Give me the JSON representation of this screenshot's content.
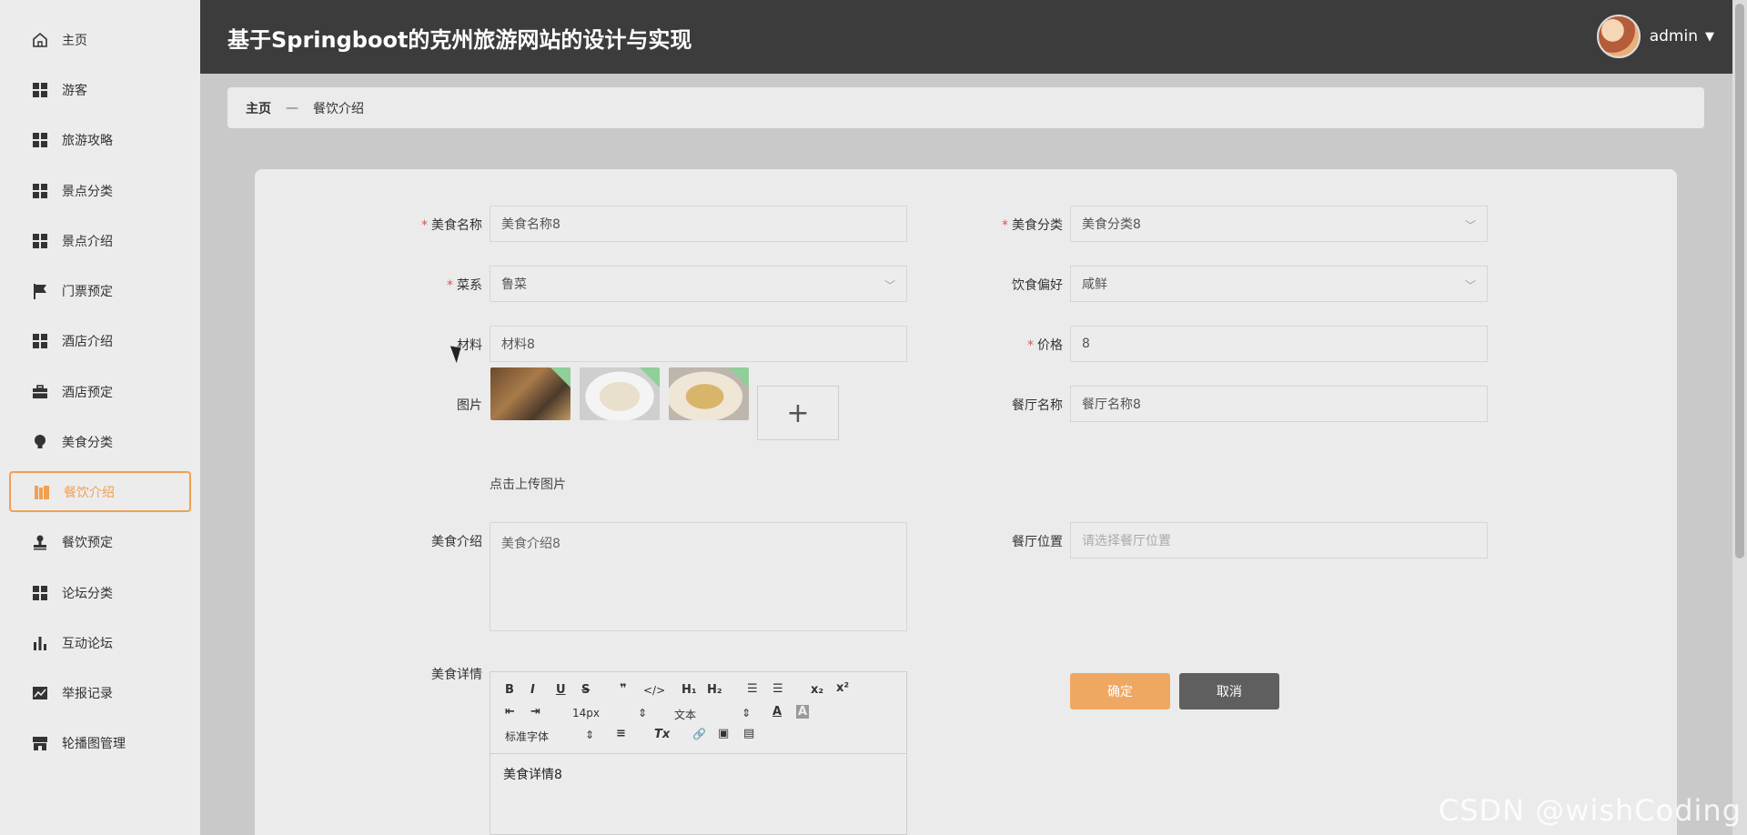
{
  "header": {
    "title": "基于Springboot的克州旅游网站的设计与实现",
    "username": "admin"
  },
  "sidebar": {
    "items": [
      {
        "label": "主页",
        "icon": "home-icon"
      },
      {
        "label": "游客",
        "icon": "grid-icon"
      },
      {
        "label": "旅游攻略",
        "icon": "grid-icon"
      },
      {
        "label": "景点分类",
        "icon": "grid-icon"
      },
      {
        "label": "景点介绍",
        "icon": "grid-icon"
      },
      {
        "label": "门票预定",
        "icon": "flag-icon"
      },
      {
        "label": "酒店介绍",
        "icon": "grid-icon"
      },
      {
        "label": "酒店预定",
        "icon": "briefcase-icon"
      },
      {
        "label": "美食分类",
        "icon": "bulb-icon"
      },
      {
        "label": "餐饮介绍",
        "icon": "books-icon"
      },
      {
        "label": "餐饮预定",
        "icon": "stamp-icon"
      },
      {
        "label": "论坛分类",
        "icon": "grid-icon"
      },
      {
        "label": "互动论坛",
        "icon": "bar-chart-icon"
      },
      {
        "label": "举报记录",
        "icon": "line-chart-icon"
      },
      {
        "label": "轮播图管理",
        "icon": "shop-icon"
      }
    ],
    "active_index": 9
  },
  "breadcrumb": {
    "home": "主页",
    "separator": "—",
    "current": "餐饮介绍"
  },
  "form": {
    "food_name": {
      "label": "美食名称",
      "value": "美食名称8"
    },
    "food_category": {
      "label": "美食分类",
      "value": "美食分类8"
    },
    "cuisine": {
      "label": "菜系",
      "value": "鲁菜"
    },
    "diet_preference": {
      "label": "饮食偏好",
      "value": "咸鲜"
    },
    "material": {
      "label": "材料",
      "value": "材料8"
    },
    "price": {
      "label": "价格",
      "value": "8"
    },
    "image": {
      "label": "图片",
      "upload_hint": "点击上传图片",
      "upload_symbol": "+"
    },
    "restaurant_name": {
      "label": "餐厅名称",
      "value": "餐厅名称8"
    },
    "food_intro": {
      "label": "美食介绍",
      "value": "美食介绍8"
    },
    "restaurant_location": {
      "label": "餐厅位置",
      "placeholder": "请选择餐厅位置"
    },
    "food_detail": {
      "label": "美食详情",
      "content": "美食详情8"
    },
    "required_mark": "*"
  },
  "editor_toolbar": {
    "bold": "B",
    "italic": "I",
    "underline": "U",
    "strike": "S",
    "quote": "❞",
    "code": "</>",
    "h1": "H₁",
    "h2": "H₂",
    "ordered_list": "☰",
    "bullet_list": "☰",
    "sub": "x₂",
    "sup": "x²",
    "outdent": "⇤",
    "indent": "⇥",
    "font_size": "14px",
    "text_type": "文本",
    "color": "A",
    "background": "A",
    "font_family": "标准字体",
    "align": "≡",
    "clean": "Tx",
    "link": "🔗",
    "image": "▣",
    "video": "▤",
    "updown": "⇕"
  },
  "buttons": {
    "confirm": "确定",
    "cancel": "取消"
  },
  "watermark": "CSDN @wishCoding",
  "colors": {
    "accent": "#f0a050",
    "header_bg": "#3c3c3c",
    "cancel_bg": "#5f5f5f"
  }
}
